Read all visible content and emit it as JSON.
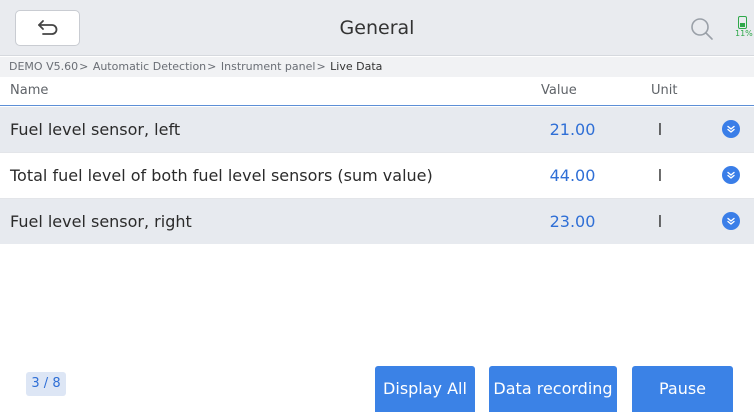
{
  "header": {
    "title": "General",
    "battery_text": "11%"
  },
  "breadcrumb": {
    "items": [
      "DEMO V5.60",
      "Automatic Detection",
      "Instrument panel",
      "Live Data"
    ],
    "separator": ">"
  },
  "table": {
    "columns": {
      "name": "Name",
      "value": "Value",
      "unit": "Unit"
    },
    "rows": [
      {
        "name": "Fuel level sensor, left",
        "value": "21.00",
        "unit": "l"
      },
      {
        "name": "Total fuel level of both fuel level sensors (sum value)",
        "value": "44.00",
        "unit": "l"
      },
      {
        "name": "Fuel level sensor, right",
        "value": "23.00",
        "unit": "l"
      }
    ]
  },
  "footer": {
    "page": "3 / 8",
    "display_all": "Display All",
    "data_recording": "Data recording",
    "pause": "Pause"
  },
  "colors": {
    "accent": "#3b82e6",
    "value_text": "#2f6fd6",
    "row_highlight": "#e7eaef",
    "battery": "#2fa84a"
  },
  "icons": {
    "back": "back-arrow-icon",
    "search": "search-icon",
    "battery": "battery-icon",
    "expand": "chevron-down-circle-icon"
  }
}
